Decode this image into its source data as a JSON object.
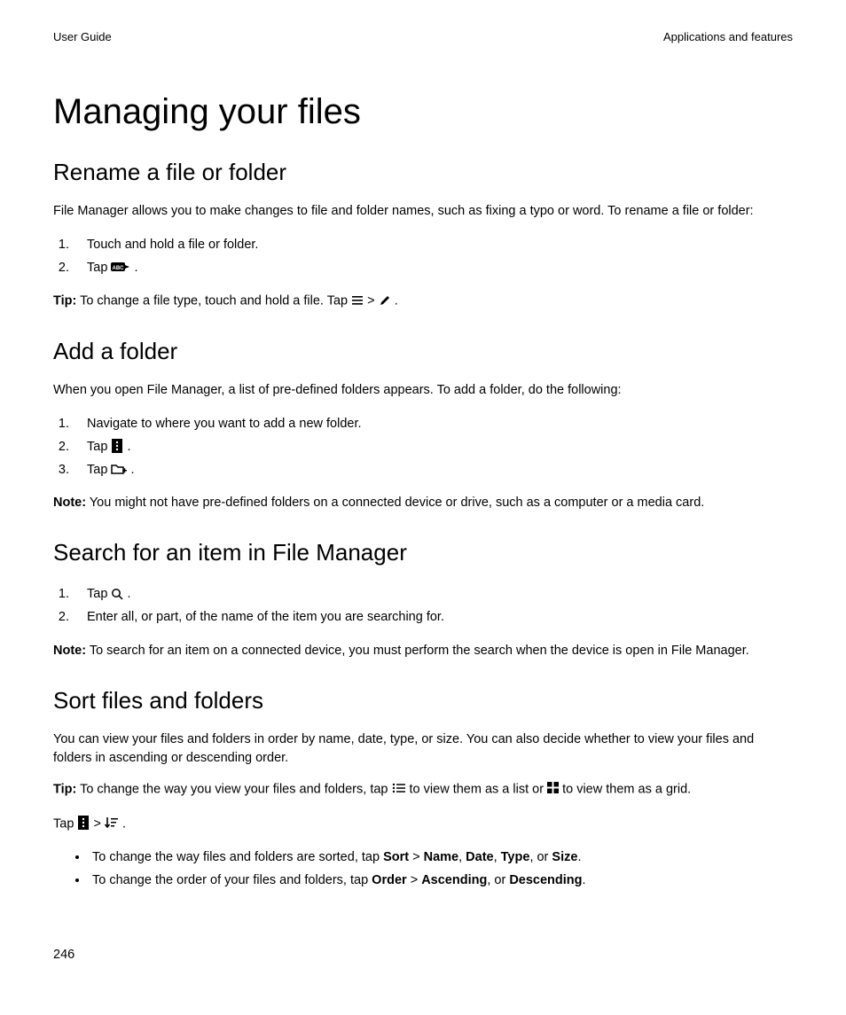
{
  "header": {
    "left": "User Guide",
    "right": "Applications and features"
  },
  "title": "Managing your files",
  "sections": {
    "rename": {
      "heading": "Rename a file or folder",
      "intro": "File Manager allows you to make changes to file and folder names, such as fixing a typo or word. To rename a file or folder:",
      "step1": "Touch and hold a file or folder.",
      "step2_pre": "Tap ",
      "step2_post": ".",
      "tip_label": "Tip:",
      "tip_pre": " To change a file type, touch and hold a file. Tap ",
      "tip_sep": "  >  ",
      "tip_post": "."
    },
    "addfolder": {
      "heading": "Add a folder",
      "intro": "When you open File Manager, a list of pre-defined folders appears. To add a folder, do the following:",
      "step1": "Navigate to where you want to add a new folder.",
      "step2_pre": "Tap ",
      "step2_post": ".",
      "step3_pre": "Tap ",
      "step3_post": ".",
      "note_label": "Note:",
      "note_text": " You might not have pre-defined folders on a connected device or drive, such as a computer or a media card."
    },
    "search": {
      "heading": "Search for an item in File Manager",
      "step1_pre": "Tap ",
      "step1_post": ".",
      "step2": "Enter all, or part, of the name of the item you are searching for.",
      "note_label": "Note:",
      "note_text": " To search for an item on a connected device, you must perform the search when the device is open in File Manager."
    },
    "sort": {
      "heading": "Sort files and folders",
      "intro": "You can view your files and folders in order by name, date, type, or size. You can also decide whether to view your files and folders in ascending or descending order.",
      "tip_label": "Tip:",
      "tip_pre": " To change the way you view your files and folders, tap ",
      "tip_mid": " to view them as a list or ",
      "tip_post": " to view them as a grid.",
      "tap_pre": "Tap ",
      "tap_sep": "  >  ",
      "tap_post": ".",
      "bullet1_pre": "To change the way files and folders are sorted, tap ",
      "bullet1_b1": "Sort",
      "bullet1_s1": " > ",
      "bullet1_b2": "Name",
      "bullet1_s2": ", ",
      "bullet1_b3": "Date",
      "bullet1_s3": ", ",
      "bullet1_b4": "Type",
      "bullet1_s4": ", or ",
      "bullet1_b5": "Size",
      "bullet1_s5": ".",
      "bullet2_pre": "To change the order of your files and folders, tap ",
      "bullet2_b1": "Order",
      "bullet2_s1": " > ",
      "bullet2_b2": "Ascending",
      "bullet2_s2": ", or ",
      "bullet2_b3": "Descending",
      "bullet2_s3": "."
    }
  },
  "page_number": "246"
}
